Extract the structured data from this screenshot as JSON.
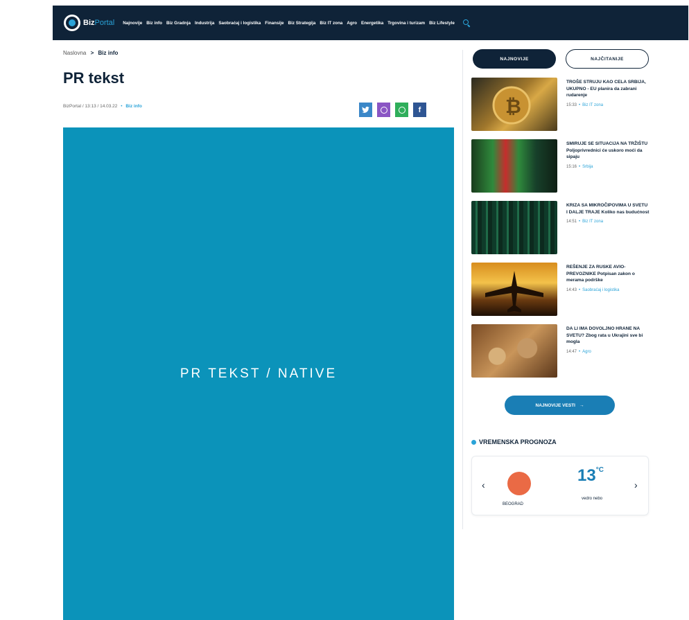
{
  "brand": {
    "name_part1": "Biz",
    "name_part2": "Portal"
  },
  "nav": {
    "items": [
      "Najnovije",
      "Biz info",
      "Biz Gradnja",
      "Industrija",
      "Saobraćaj i logistika",
      "Finansije",
      "Biz Strategija",
      "Biz IT zona",
      "Agro",
      "Energetika",
      "Trgovina i turizam",
      "Biz Lifestyle"
    ]
  },
  "breadcrumb": {
    "home": "Naslovna",
    "separator": ">",
    "current": "Biz info"
  },
  "article": {
    "title": "PR tekst",
    "meta_source": "BizPortal / 13:13 / 14.03.22",
    "meta_dot": "•",
    "meta_category": "Biz info",
    "banner_text": "PR TEKST / NATIVE"
  },
  "share": {
    "twitter": "t",
    "facebook": "f"
  },
  "sidebar": {
    "tab_latest": "NAJNOVIJE",
    "tab_popular": "NAJČITANIJE",
    "news": [
      {
        "title": "TROŠE STRUJU KAO CELA SRBIJA, UKUPNO - EU planira da zabrani rudarenje",
        "time": "15:33",
        "category": "Biz IT zona"
      },
      {
        "title": "SMIRUJE SE SITUACIJA NA TRŽIŠTU Poljoprivrednici će uskoro moći da sipaju",
        "time": "15:16",
        "category": "Srbija"
      },
      {
        "title": "KRIZA SA MIKROČIPOVIMA U SVETU I DALJE TRAJE Koliko nas budućnost",
        "time": "14:51",
        "category": "Biz IT zona"
      },
      {
        "title": "REŠENJE ZA RUSKE AVIO-PREVOZNIKE Potpisan zakon o merama podrške",
        "time": "14:43",
        "category": "Saobraćaj i logistika"
      },
      {
        "title": "DA LI IMA DOVOLJNO HRANE NA SVETU? Zbog rata u Ukrajini sve bi mogla",
        "time": "14:47",
        "category": "Agro"
      }
    ],
    "latest_button": "NAJNOVIJE VESTI",
    "latest_arrow": "→"
  },
  "weather": {
    "heading": "VREMENSKA PROGNOZA",
    "city": "BEOGRAD",
    "temperature": "13",
    "unit": "°C",
    "condition": "vedro nebo",
    "prev": "‹",
    "next": "›"
  },
  "colors": {
    "nav_bg": "#0f2338",
    "accent": "#2aa3d8",
    "banner": "#0b93ba",
    "sun": "#ea6a45"
  }
}
